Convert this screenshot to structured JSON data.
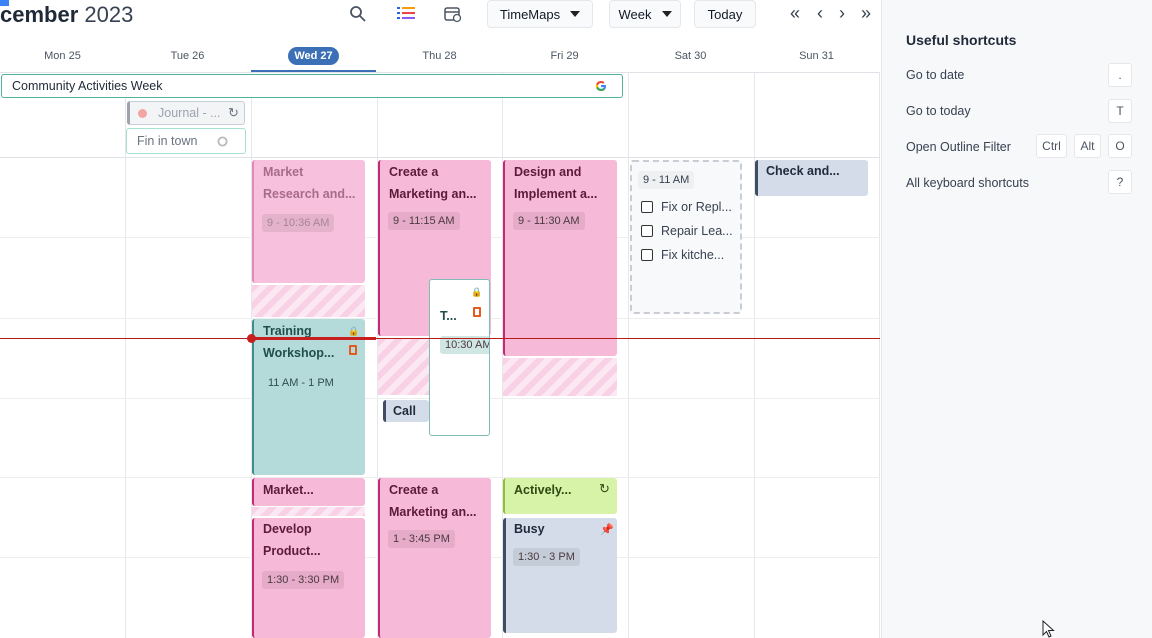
{
  "header": {
    "month": "cember",
    "year": "2023",
    "view_selector": "TimeMaps",
    "range_selector": "Week",
    "today_button": "Today"
  },
  "days": [
    {
      "label": "Mon 25"
    },
    {
      "label": "Tue 26"
    },
    {
      "label": "Wed 27",
      "today": true
    },
    {
      "label": "Thu 28"
    },
    {
      "label": "Fri 29"
    },
    {
      "label": "Sat 30"
    },
    {
      "label": "Sun 31"
    }
  ],
  "all_day": {
    "banner": "Community Activities Week",
    "journal": "Journal - ...",
    "fin": "Fin in town"
  },
  "events": {
    "market_research": {
      "title": "Market Research and...",
      "time": "9 - 10:36 AM"
    },
    "create_marketing_1": {
      "title": "Create a Marketing an...",
      "time": "9 - 11:15 AM"
    },
    "design_implement": {
      "title": "Design and Implement a...",
      "time": "9 - 11:30 AM"
    },
    "sat_tasks": {
      "time": "9 - 11 AM",
      "items": [
        "Fix or Repl...",
        "Repair Lea...",
        "Fix kitche..."
      ]
    },
    "check_and": {
      "title": "Check and..."
    },
    "training": {
      "title": "Training Workshop...",
      "time": "11 AM - 1 PM"
    },
    "t_event": {
      "title": "T...",
      "time": "10:30 AM"
    },
    "call": {
      "title": "Call M"
    },
    "market_small": {
      "title": "Market..."
    },
    "create_marketing_2": {
      "title": "Create a Marketing an...",
      "time": "1 - 3:45 PM"
    },
    "actively": {
      "title": "Actively..."
    },
    "develop": {
      "title": "Develop Product...",
      "time": "1:30 - 3:30 PM"
    },
    "busy": {
      "title": "Busy",
      "time": "1:30 - 3 PM"
    }
  },
  "panel": {
    "title": "Useful shortcuts",
    "shortcuts": [
      {
        "label": "Go to date",
        "keys": [
          "."
        ]
      },
      {
        "label": "Go to today",
        "keys": [
          "T"
        ]
      },
      {
        "label": "Open Outline Filter",
        "keys": [
          "Ctrl",
          "Alt",
          "O"
        ]
      },
      {
        "label": "All keyboard shortcuts",
        "keys": [
          "?"
        ]
      }
    ]
  },
  "colors": {
    "accent": "#3b6fb6",
    "now_line": "#c81e1e",
    "event_pink": "#f7b9d8",
    "event_teal": "#b4dada",
    "event_blue": "#d3dce8",
    "event_green": "#d7f3a8"
  },
  "icons": [
    "search-icon",
    "list-icon",
    "calendar-sync-icon",
    "double-chevron-left-icon",
    "chevron-left-icon",
    "chevron-right-icon",
    "double-chevron-right-icon",
    "google-icon",
    "recurring-icon",
    "lock-icon",
    "office-icon",
    "pin-icon",
    "mouse-cursor-icon"
  ]
}
